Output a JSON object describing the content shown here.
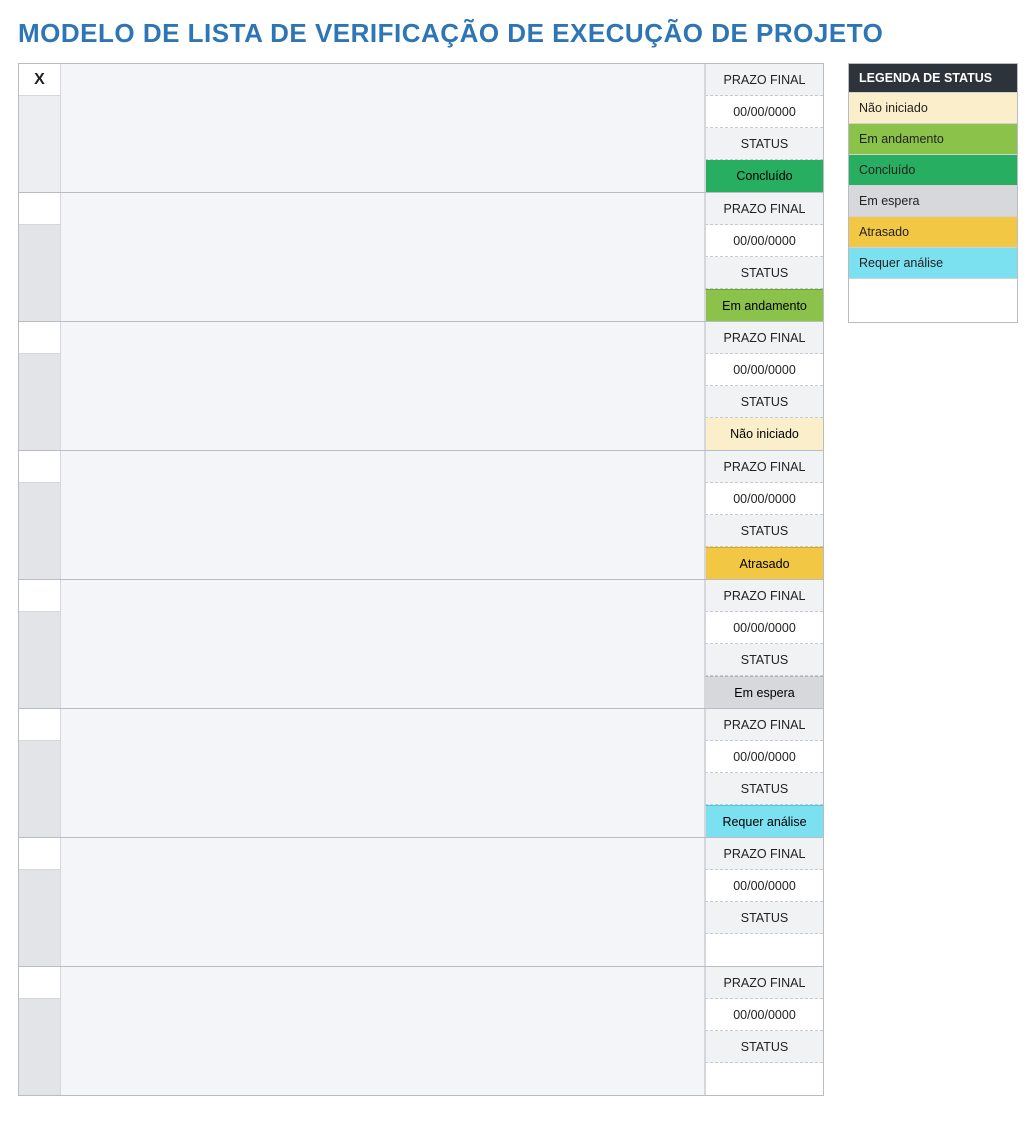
{
  "title": "MODELO DE LISTA DE VERIFICAÇÃO DE EXECUÇÃO DE PROJETO",
  "header": {
    "check_mark": "X"
  },
  "labels": {
    "deadline": "PRAZO FINAL",
    "status": "STATUS"
  },
  "status_values": {
    "concluido": "Concluído",
    "andamento": "Em andamento",
    "naoiniciado": "Não iniciado",
    "atrasado": "Atrasado",
    "emespera": "Em espera",
    "requer": "Requer análise",
    "blank": ""
  },
  "colors": {
    "title_accent": "#2E75B6",
    "concluido": "#27ae60",
    "andamento": "#8bc34a",
    "naoiniciado": "#faeecb",
    "atrasado": "#f2c744",
    "emespera": "#d6d8dc",
    "requer": "#7be0f0",
    "legend_header_bg": "#2d333a"
  },
  "tasks": [
    {
      "check": "X",
      "date": "00/00/0000",
      "status_key": "concluido"
    },
    {
      "check": "",
      "date": "00/00/0000",
      "status_key": "andamento"
    },
    {
      "check": "",
      "date": "00/00/0000",
      "status_key": "naoiniciado"
    },
    {
      "check": "",
      "date": "00/00/0000",
      "status_key": "atrasado"
    },
    {
      "check": "",
      "date": "00/00/0000",
      "status_key": "emespera"
    },
    {
      "check": "",
      "date": "00/00/0000",
      "status_key": "requer"
    },
    {
      "check": "",
      "date": "00/00/0000",
      "status_key": "blank"
    },
    {
      "check": "",
      "date": "00/00/0000",
      "status_key": "blank"
    }
  ],
  "legend": {
    "header": "LEGENDA DE STATUS",
    "items": [
      {
        "key": "naoiniciado",
        "label": "Não iniciado"
      },
      {
        "key": "andamento",
        "label": "Em andamento"
      },
      {
        "key": "concluido",
        "label": "Concluído"
      },
      {
        "key": "emespera",
        "label": "Em espera"
      },
      {
        "key": "atrasado",
        "label": "Atrasado"
      },
      {
        "key": "requer",
        "label": "Requer análise"
      }
    ]
  }
}
